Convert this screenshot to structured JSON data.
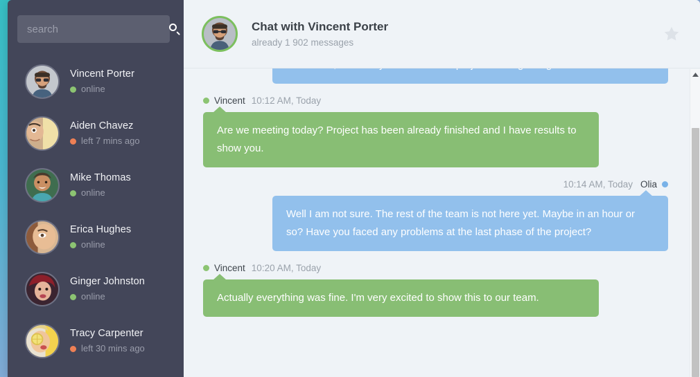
{
  "theme": {
    "teal": "#37c0c4",
    "sidebar_bg": "#434659",
    "chat_bg": "#eff3f7",
    "bubble_green": "#88be74",
    "bubble_blue": "#92c0ec",
    "status_online": "#8cc472",
    "status_away": "#ee8055"
  },
  "sidebar": {
    "search": {
      "placeholder": "search",
      "value": "",
      "icon": "search-icon"
    },
    "contacts": [
      {
        "name": "Vincent Porter",
        "status": "online",
        "state": "online"
      },
      {
        "name": "Aiden Chavez",
        "status": "left 7 mins ago",
        "state": "away"
      },
      {
        "name": "Mike Thomas",
        "status": "online",
        "state": "online"
      },
      {
        "name": "Erica Hughes",
        "status": "online",
        "state": "online"
      },
      {
        "name": "Ginger Johnston",
        "status": "online",
        "state": "online"
      },
      {
        "name": "Tracy Carpenter",
        "status": "left 30 mins ago",
        "state": "away"
      }
    ]
  },
  "header": {
    "title": "Chat with Vincent Porter",
    "subtitle": "already 1 902 messages",
    "star_icon": "star-icon",
    "avatar_icon": "avatar"
  },
  "messages": [
    {
      "side": "right",
      "author": "",
      "time": "",
      "state": "",
      "text": "Hi Vincent, how are you? How is the project coming along?",
      "show_meta": false,
      "show_tail": false
    },
    {
      "side": "left",
      "author": "Vincent",
      "time": "10:12 AM, Today",
      "state": "online",
      "text": "Are we meeting today? Project has been already finished and I have results to show you.",
      "show_meta": true,
      "show_tail": true
    },
    {
      "side": "right",
      "author": "Olia",
      "time": "10:14 AM, Today",
      "state": "self",
      "text": "Well I am not sure. The rest of the team is not here yet. Maybe in an hour or so? Have you faced any problems at the last phase of the project?",
      "show_meta": true,
      "show_tail": true
    },
    {
      "side": "left",
      "author": "Vincent",
      "time": "10:20 AM, Today",
      "state": "online",
      "text": "Actually everything was fine. I'm very excited to show this to our team.",
      "show_meta": true,
      "show_tail": true
    }
  ],
  "scrollbar": {
    "up_arrow_icon": "chevron-up-icon",
    "thumb_label": "scroll-thumb"
  }
}
